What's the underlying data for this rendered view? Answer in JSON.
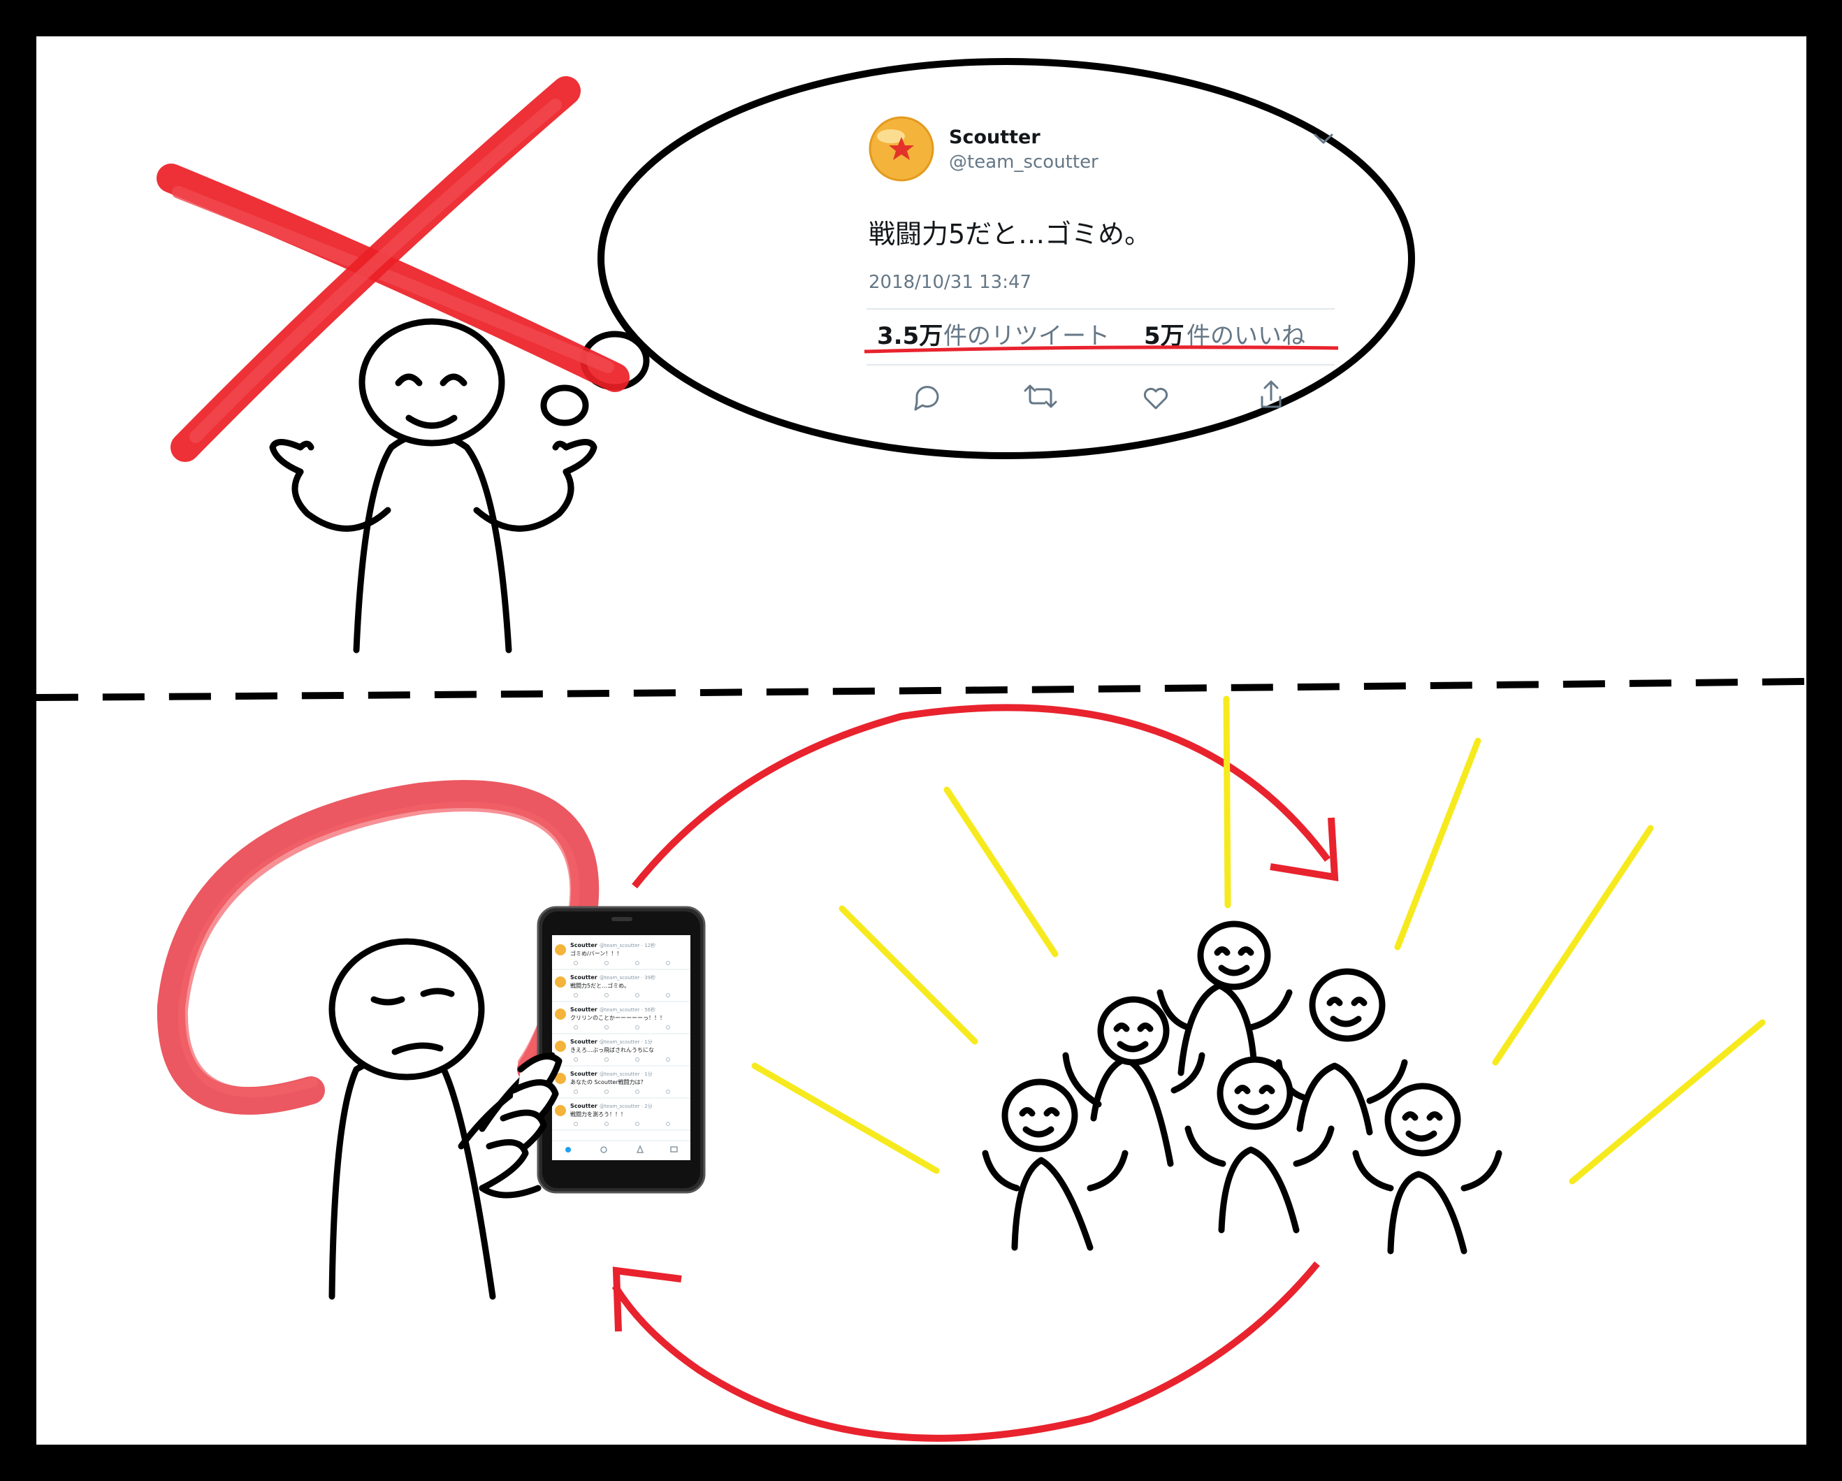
{
  "tweet": {
    "name": "Scoutter",
    "handle": "@team_scoutter",
    "text": "戦闘力5だと…ゴミめ。",
    "date": "2018/10/31 13:47",
    "retweets_count": "3.5万",
    "retweets_label": "件のリツイート",
    "likes_count": "5万",
    "likes_label": "件のいいね",
    "avatar_icon": "dragon-ball-star-icon",
    "actions": [
      "reply-icon",
      "retweet-icon",
      "like-icon",
      "share-icon"
    ]
  },
  "phone_feed": [
    {
      "name": "Scoutter",
      "handle": "@team_scoutter · 12秒",
      "text": "ゴミめ/バーン！！！"
    },
    {
      "name": "Scoutter",
      "handle": "@team_scoutter · 39秒",
      "text": "戦闘力5だと…ゴミめ。"
    },
    {
      "name": "Scoutter",
      "handle": "@team_scoutter · 56秒",
      "text": "クリリンのことかーーーーーっ！！！"
    },
    {
      "name": "Scoutter",
      "handle": "@team_scoutter · 1分",
      "text": "きえろ…ぶっ飛ばされんうちにな"
    },
    {
      "name": "Scoutter",
      "handle": "@team_scoutter · 1分",
      "text": "あなたの Scoutter戦闘力は？"
    },
    {
      "name": "Scoutter",
      "handle": "@team_scoutter · 2分",
      "text": "戦闘力を測ろう！！！"
    }
  ],
  "colors": {
    "frame": "#000000",
    "accent_red": "#e8232e",
    "scribble_red": "#e8414b",
    "ray_yellow": "#f6ea1e",
    "twitter_gray": "#657786"
  }
}
